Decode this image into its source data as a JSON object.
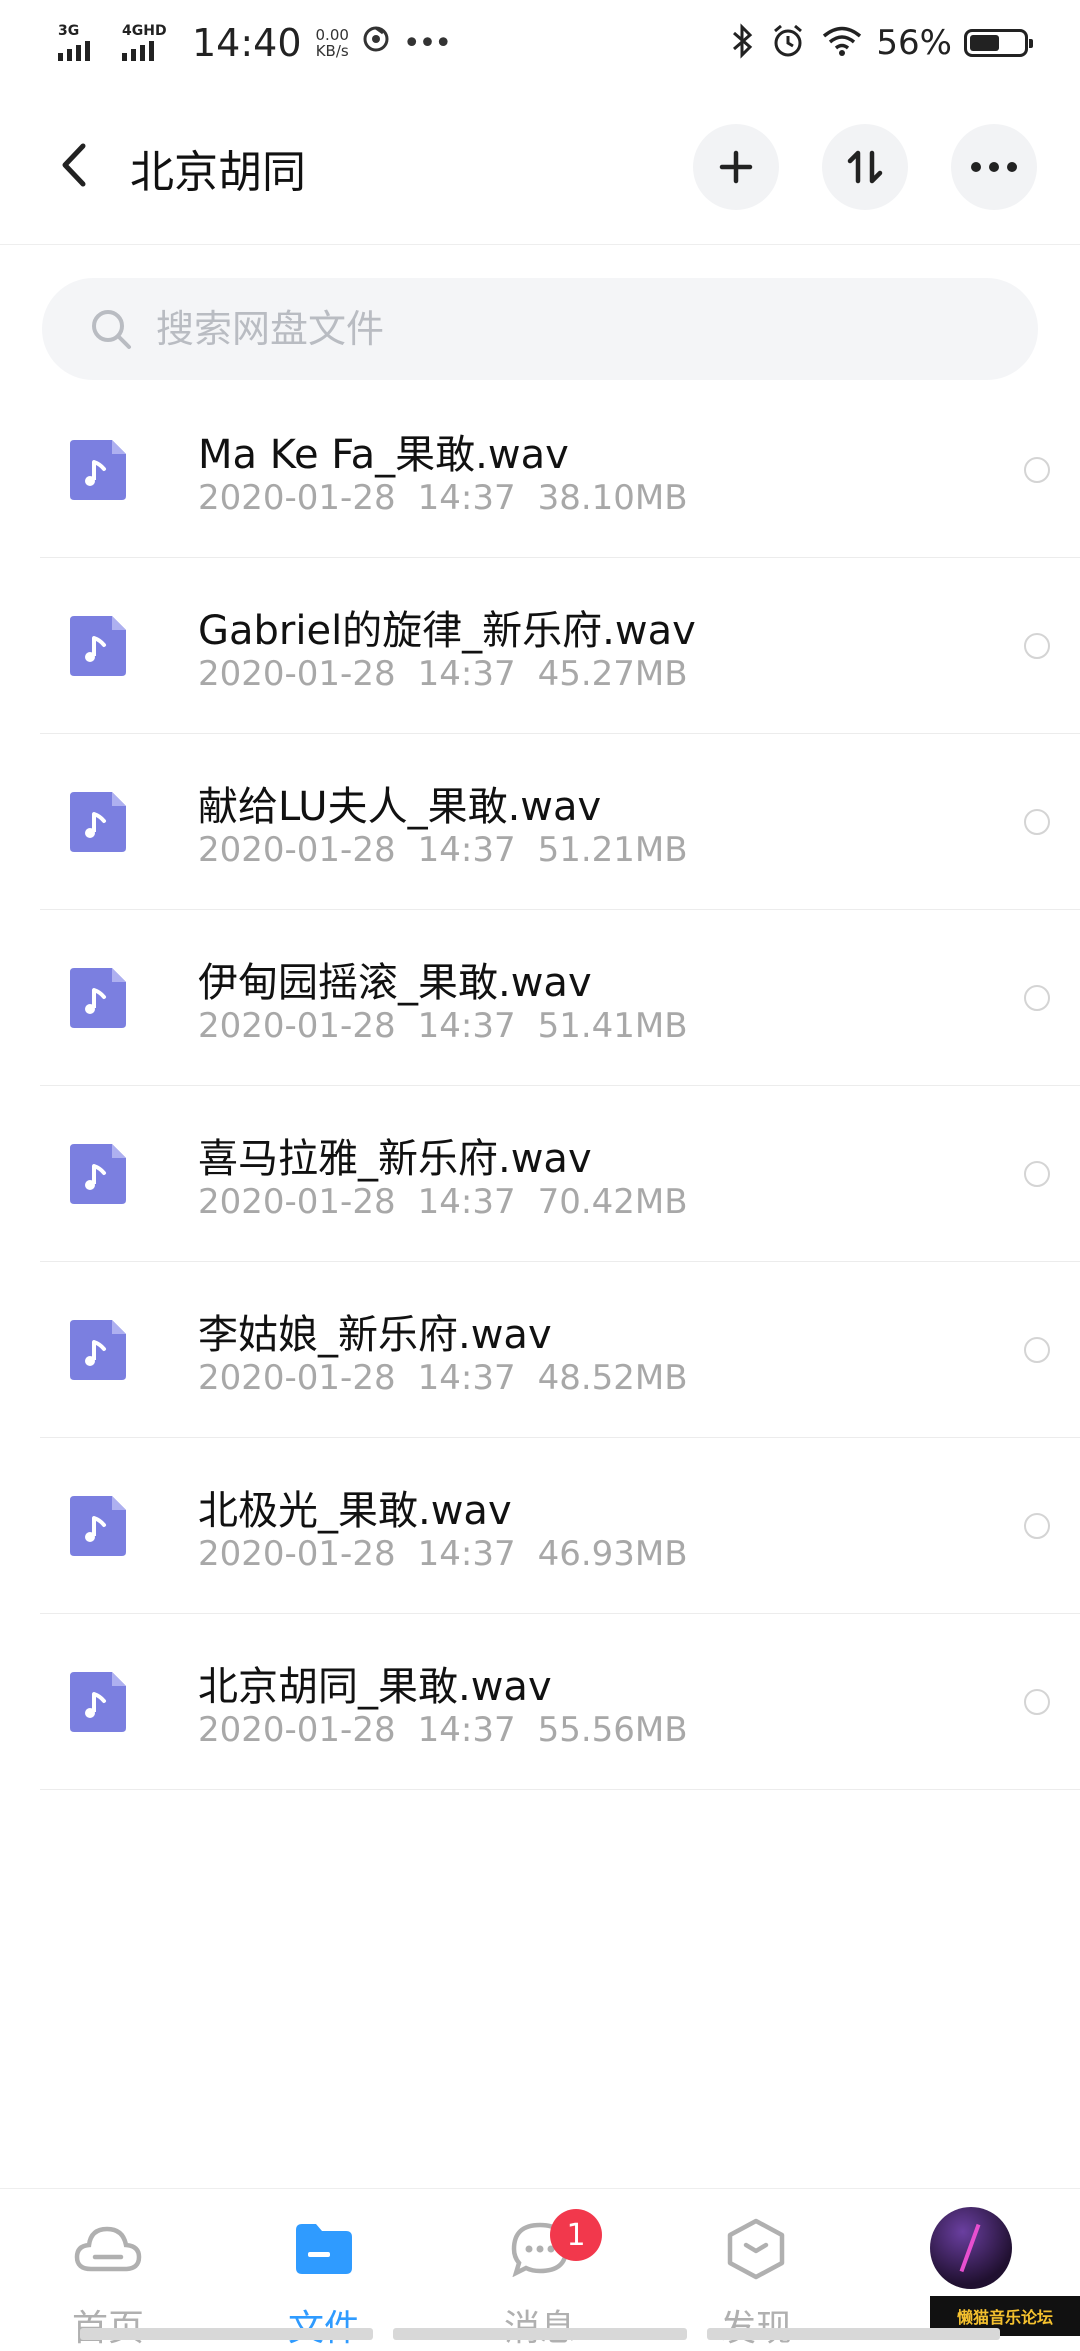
{
  "status_bar": {
    "net1": "3G",
    "net2": "4GHD",
    "time": "14:40",
    "speed_value": "0.00",
    "speed_unit": "KB/s",
    "battery_percent": "56%",
    "battery_level": 0.56
  },
  "header": {
    "title": "北京胡同"
  },
  "search": {
    "placeholder": "搜索网盘文件"
  },
  "files": [
    {
      "name": "Ma Ke Fa_果敢.wav",
      "date": "2020-01-28",
      "time": "14:37",
      "size": "38.10MB"
    },
    {
      "name": "Gabriel的旋律_新乐府.wav",
      "date": "2020-01-28",
      "time": "14:37",
      "size": "45.27MB"
    },
    {
      "name": "献给LU夫人_果敢.wav",
      "date": "2020-01-28",
      "time": "14:37",
      "size": "51.21MB"
    },
    {
      "name": "伊甸园摇滚_果敢.wav",
      "date": "2020-01-28",
      "time": "14:37",
      "size": "51.41MB"
    },
    {
      "name": "喜马拉雅_新乐府.wav",
      "date": "2020-01-28",
      "time": "14:37",
      "size": "70.42MB"
    },
    {
      "name": "李姑娘_新乐府.wav",
      "date": "2020-01-28",
      "time": "14:37",
      "size": "48.52MB"
    },
    {
      "name": "北极光_果敢.wav",
      "date": "2020-01-28",
      "time": "14:37",
      "size": "46.93MB"
    },
    {
      "name": "北京胡同_果敢.wav",
      "date": "2020-01-28",
      "time": "14:37",
      "size": "55.56MB"
    }
  ],
  "tabs": [
    {
      "label": "首页",
      "icon": "cloud-icon"
    },
    {
      "label": "文件",
      "icon": "folder-icon",
      "active": true
    },
    {
      "label": "消息",
      "icon": "chat-icon",
      "badge": "1"
    },
    {
      "label": "发现",
      "icon": "discover-icon"
    }
  ],
  "watermark": "懒猫音乐论坛",
  "colors": {
    "accent": "#2f9bff",
    "file_icon": "#7b7fe0",
    "badge": "#f2384c"
  }
}
